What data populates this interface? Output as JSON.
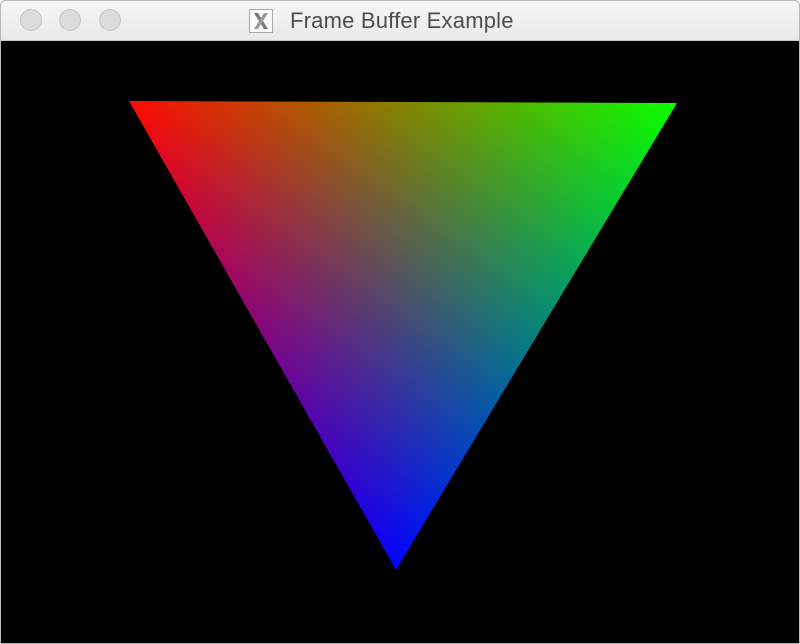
{
  "window": {
    "title": "Frame Buffer Example",
    "app_icon": "x11-icon"
  },
  "titlebar": {
    "buttons": [
      {
        "name": "close",
        "color": "#dcdcdc"
      },
      {
        "name": "minimize",
        "color": "#dcdcdc"
      },
      {
        "name": "zoom",
        "color": "#dcdcdc"
      }
    ]
  },
  "canvas": {
    "background": "#000000",
    "triangle": {
      "vertex_colors": {
        "top_left": "#ff0000",
        "top_right": "#00ff00",
        "bottom": "#0000ff"
      }
    }
  }
}
